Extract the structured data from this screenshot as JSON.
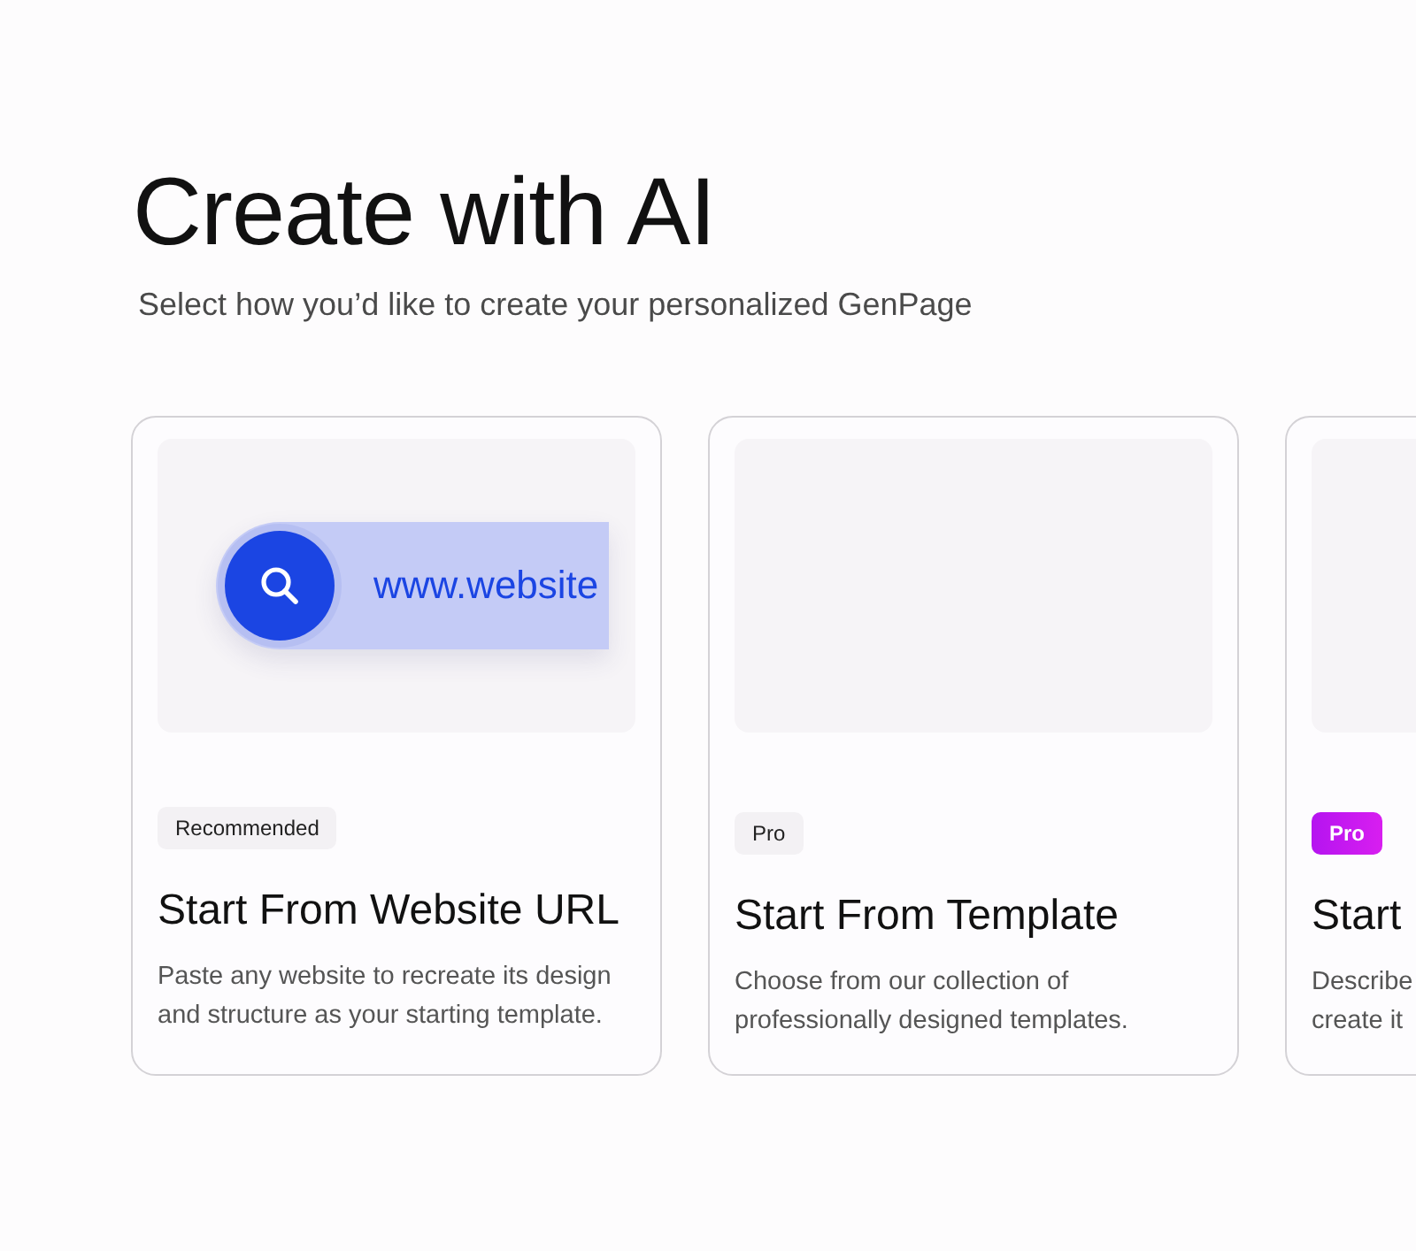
{
  "heading": "Create with AI",
  "subtitle": "Select how you’d like to create your personalized GenPage",
  "cards": [
    {
      "preview": {
        "kind": "url-search",
        "text": "www.website"
      },
      "badge": {
        "kind": "plain",
        "label": "Recommended"
      },
      "title": "Start From Website URL",
      "description_lines": [
        "Paste any website to recreate its design",
        "and structure as your starting template."
      ]
    },
    {
      "preview": {
        "kind": "empty"
      },
      "badge": {
        "kind": "plain",
        "label": "Pro"
      },
      "title": "Start From Template",
      "description_lines": [
        "Choose from our collection of",
        "professionally designed templates."
      ]
    },
    {
      "preview": {
        "kind": "empty"
      },
      "badge": {
        "kind": "highlight",
        "label": "Pro"
      },
      "title": "Start",
      "description_lines": [
        "Describe",
        "create it"
      ]
    }
  ]
}
